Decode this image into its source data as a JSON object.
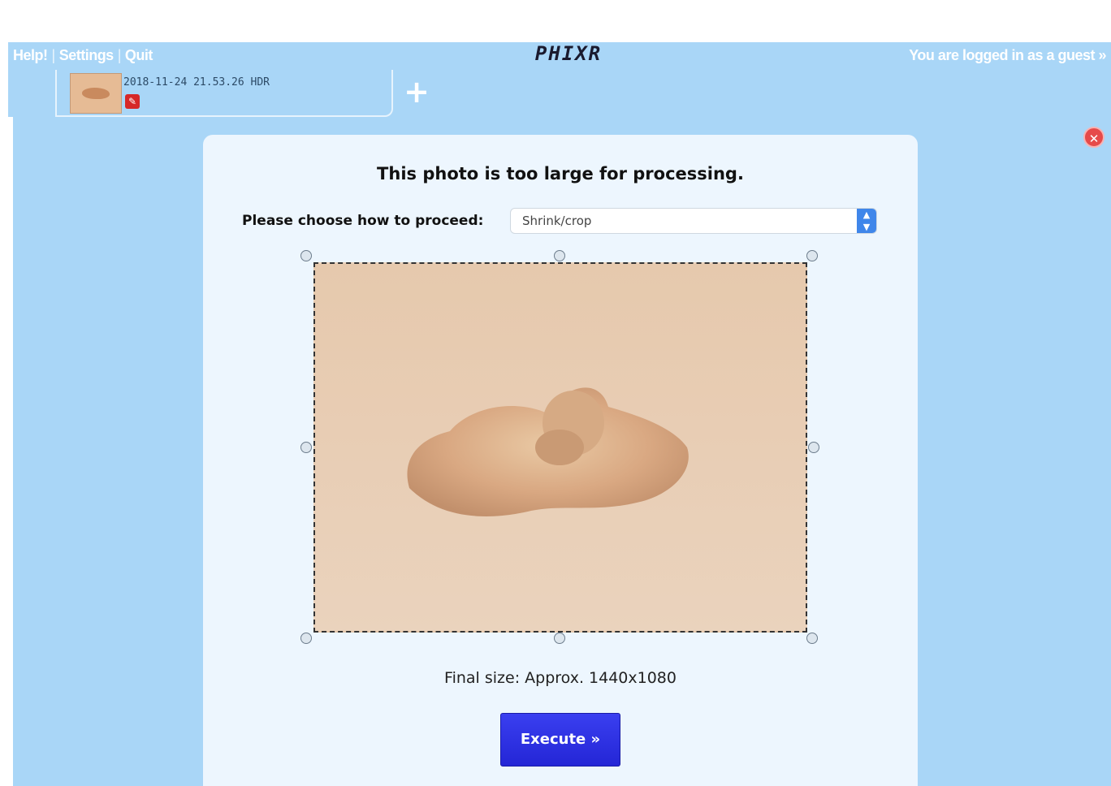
{
  "topbar": {
    "links": [
      "Help!",
      "Settings",
      "Quit"
    ],
    "separator": "|",
    "logo": "PHIXR",
    "login_text": "You are logged in as a guest »"
  },
  "tabs": {
    "items": [
      {
        "label": "2018-11-24 21.53.26 HDR",
        "badge_icon": "warning-icon"
      }
    ],
    "add_label": "+"
  },
  "dialog": {
    "close_icon": "close-icon",
    "title": "This photo is too large for processing.",
    "choose_label": "Please choose how to proceed:",
    "choice_value": "Shrink/crop",
    "final_size": "Final size: Approx. 1440x1080",
    "execute_label": "Execute »"
  },
  "colors": {
    "accent": "#a9d6f7",
    "panel": "#edf6fe",
    "execute": "#2b2fe3",
    "close": "#e64a4a"
  }
}
